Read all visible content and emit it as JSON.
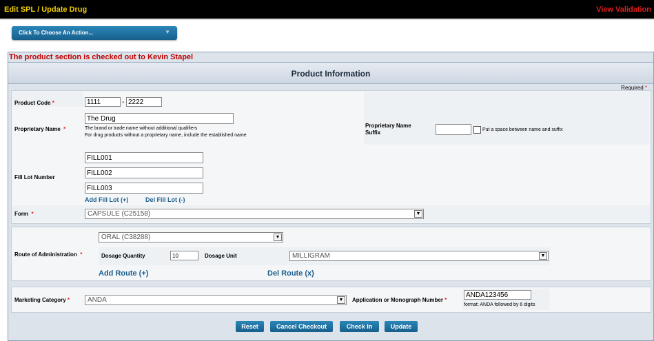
{
  "topbar": {
    "title": "Edit SPL  /  Update Drug",
    "view_validation": "View Validation"
  },
  "action_menu": {
    "label": "Click To Choose An Action..."
  },
  "checkout_notice": "The product section is checked out to Kevin Stapel",
  "section_title": "Product Information",
  "required_label": "Required",
  "required_star": "*",
  "product_code": {
    "label": "Product Code",
    "part1": "1111",
    "separator": "-",
    "part2": "2222"
  },
  "proprietary_name": {
    "label": "Proprietary Name",
    "value": "The Drug",
    "hint1": "The brand or trade name without additional qualifiers",
    "hint2": "For drug products without a proprietary name, include the established name"
  },
  "suffix": {
    "label_line1": "Proprietary Name",
    "label_line2": "Suffix",
    "value": "",
    "checkbox_label": "Put a space between name and suffix"
  },
  "fill_lot": {
    "label": "Fill Lot Number",
    "values": [
      "FILL001",
      "FILL002",
      "FILL003"
    ],
    "add_label": "Add Fill Lot (+)",
    "del_label": "Del Fill Lot (-)"
  },
  "form": {
    "label": "Form",
    "value": "CAPSULE (C25158)"
  },
  "route": {
    "label": "Route of Administration",
    "value": "ORAL (C38288)",
    "dosage_qty_label": "Dosage Quantity",
    "dosage_qty": "10",
    "dosage_unit_label": "Dosage Unit",
    "dosage_unit": "MILLIGRAM",
    "add_label": "Add Route (+)",
    "del_label": "Del Route (x)"
  },
  "marketing": {
    "label": "Marketing Category",
    "value": "ANDA",
    "app_label": "Application or Monograph Number",
    "app_value": "ANDA123456",
    "app_hint": "format: ANDA followed by 6 digits"
  },
  "buttons": {
    "reset": "Reset",
    "cancel": "Cancel Checkout",
    "checkin": "Check In",
    "update": "Update"
  }
}
